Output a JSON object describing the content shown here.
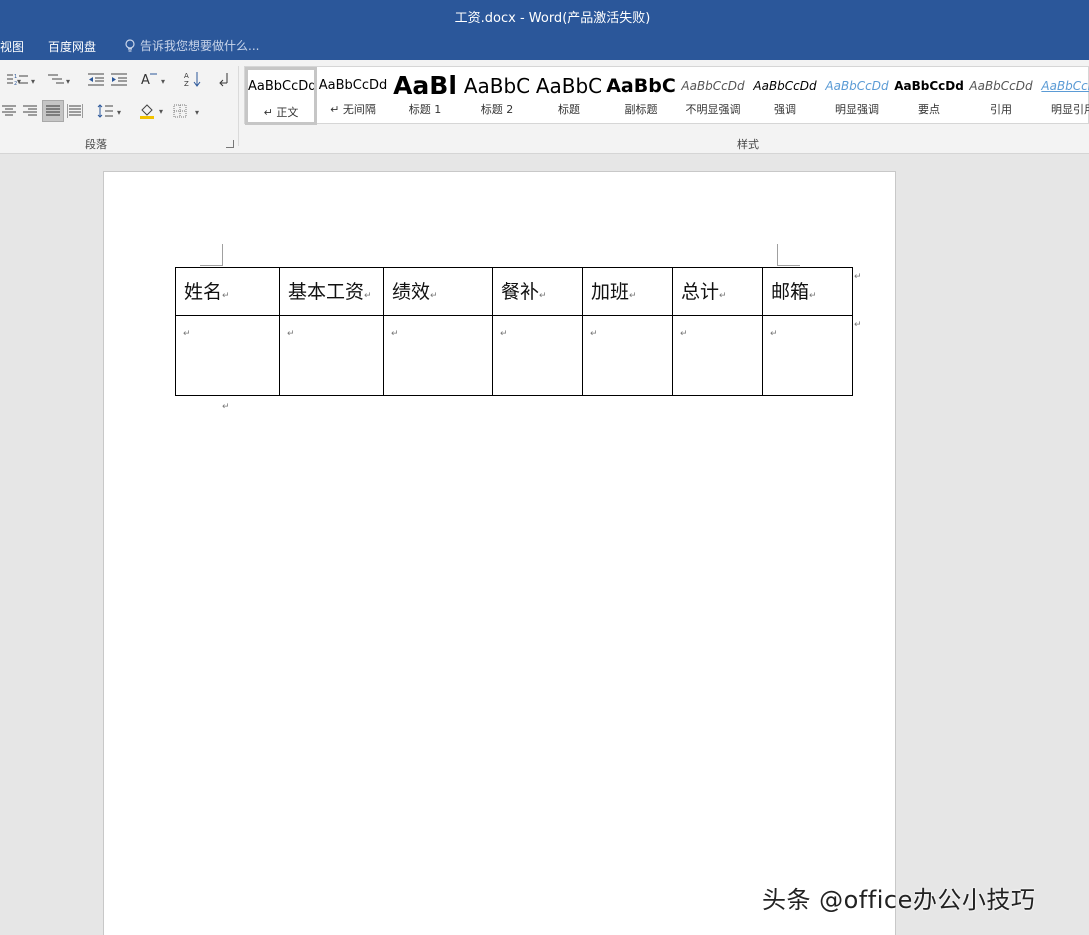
{
  "window": {
    "title": "工资.docx - Word(产品激活失败)"
  },
  "menu": {
    "partial_tab": "视图",
    "baidu_tab": "百度网盘",
    "tell_me": "告诉我您想要做什么..."
  },
  "ribbon": {
    "paragraph_group": "段落",
    "styles_group": "样式",
    "styles": [
      {
        "sample": "AaBbCcDd",
        "label": "↵ 正文"
      },
      {
        "sample": "AaBbCcDd",
        "label": "↵ 无间隔"
      },
      {
        "sample": "AaBl",
        "label": "标题 1"
      },
      {
        "sample": "AaBbC",
        "label": "标题 2"
      },
      {
        "sample": "AaBbC",
        "label": "标题"
      },
      {
        "sample": "AaBbC",
        "label": "副标题"
      },
      {
        "sample": "AaBbCcDd",
        "label": "不明显强调"
      },
      {
        "sample": "AaBbCcDd",
        "label": "强调"
      },
      {
        "sample": "AaBbCcDd",
        "label": "明显强调"
      },
      {
        "sample": "AaBbCcDd",
        "label": "要点"
      },
      {
        "sample": "AaBbCcDd",
        "label": "引用"
      },
      {
        "sample": "AaBbCcDd",
        "label": "明显引用"
      }
    ]
  },
  "document": {
    "table": {
      "headers": [
        "姓名",
        "基本工资",
        "绩效",
        "餐补",
        "加班",
        "总计",
        "邮箱"
      ],
      "cell_mark": "↵"
    },
    "paragraph_mark": "↵"
  },
  "watermark": "头条 @office办公小技巧"
}
